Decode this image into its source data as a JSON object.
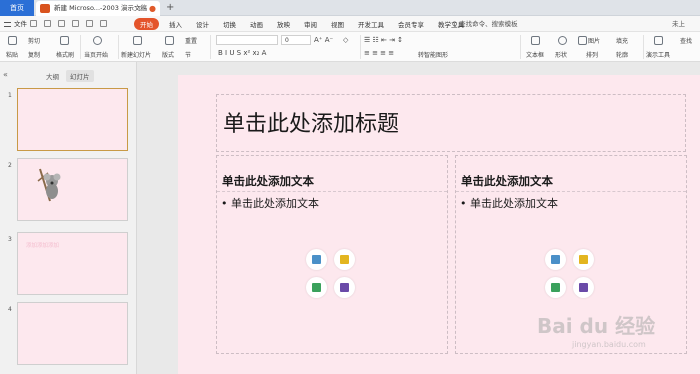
{
  "tabs": {
    "home": "首页",
    "document": "新建 Microso...-2003 演示文稿",
    "new_tab": "+"
  },
  "menu": {
    "file": "文件",
    "items": [
      "开始",
      "插入",
      "设计",
      "切换",
      "动画",
      "放映",
      "审阅",
      "视图",
      "开发工具",
      "会员专享",
      "教学工具"
    ],
    "search": "Q 查找命令、搜索模板",
    "cloud": "未上"
  },
  "ribbon": {
    "paste": "粘贴",
    "cut": "剪切",
    "copy": "复制",
    "format_painter": "格式刷",
    "start_from_current": "当页开始",
    "new_slide": "新建幻灯片",
    "layout": "版式",
    "reset": "重置",
    "section": "节",
    "font_size_value": "0",
    "convert_smartart": "转智能图形",
    "textbox": "文本框",
    "shape": "形状",
    "picture": "图片",
    "arrange": "排列",
    "fill": "填充",
    "outline": "轮廓",
    "presenter_tools": "演示工具",
    "find": "查找"
  },
  "left_panel": {
    "collapse": "«",
    "tab_outline": "大纲",
    "tab_slides": "幻灯片",
    "slides": [
      {
        "num": "1"
      },
      {
        "num": "2"
      },
      {
        "num": "3",
        "faint_text": "添加添加添加"
      },
      {
        "num": "4"
      }
    ]
  },
  "slide": {
    "title": "单击此处添加标题",
    "left_heading": "单击此处添加文本",
    "left_bullet": "• 单击此处添加文本",
    "right_heading": "单击此处添加文本",
    "right_bullet": "• 单击此处添加文本"
  },
  "watermark": {
    "brand": "Bai du 经验",
    "url": "jingyan.baidu.com"
  },
  "colors": {
    "home_tab": "#2b6fd6",
    "active_menu": "#e4542b",
    "slide_bg": "#fde8ee"
  }
}
